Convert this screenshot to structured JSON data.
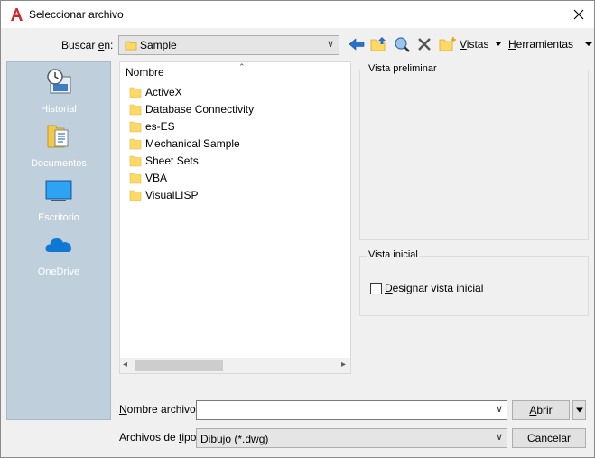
{
  "window": {
    "title": "Seleccionar archivo"
  },
  "lookin": {
    "label_prefix": "Buscar ",
    "label_underline": "e",
    "label_suffix": "n:",
    "value": "Sample"
  },
  "toolbar": {
    "vistas_underline": "V",
    "vistas_rest": "istas",
    "herramientas_underline": "H",
    "herramientas_rest": "erramientas"
  },
  "places": [
    {
      "label": "Historial",
      "icon": "history-icon"
    },
    {
      "label": "Documentos",
      "icon": "documents-icon"
    },
    {
      "label": "Escritorio",
      "icon": "desktop-icon"
    },
    {
      "label": "OneDrive",
      "icon": "onedrive-icon"
    }
  ],
  "filelist": {
    "column_header": "Nombre",
    "items": [
      "ActiveX",
      "Database Connectivity",
      "es-ES",
      "Mechanical Sample",
      "Sheet Sets",
      "VBA",
      "VisualLISP"
    ]
  },
  "preview": {
    "title": "Vista preliminar"
  },
  "initial_view": {
    "title": "Vista inicial",
    "checkbox_underline": "D",
    "checkbox_rest": "esignar vista inicial",
    "checked": false
  },
  "filename": {
    "label_prefix": "",
    "label_underline": "N",
    "label_suffix": "ombre archivo:",
    "value": ""
  },
  "filetype": {
    "label_prefix": "Archivos de ",
    "label_underline": "t",
    "label_suffix": "ipo:",
    "value": "Dibujo (*.dwg)"
  },
  "buttons": {
    "open_underline": "A",
    "open_rest": "brir",
    "cancel": "Cancelar"
  },
  "colors": {
    "sidebar_bg": "#c0cfdc",
    "folder_yellow": "#ffd966",
    "app_red": "#d8232a",
    "nav_blue": "#2a6fc9"
  }
}
